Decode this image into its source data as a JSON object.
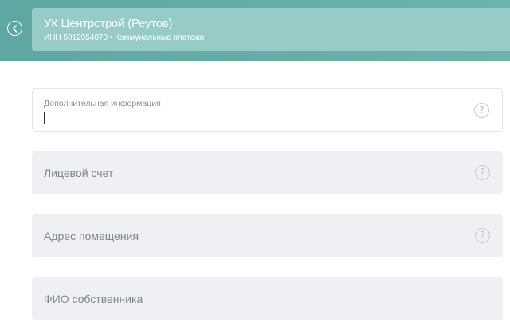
{
  "header": {
    "back_icon": "chevron-left-icon",
    "merchant": {
      "title": "УК Центрстрой (Реутов)",
      "subtitle": "ИНН 5012054070 • Коммунальные платежи"
    }
  },
  "form": {
    "fields": [
      {
        "label": "Дополнительная информация",
        "value": "",
        "state": "focused",
        "help_icon": "question-icon",
        "help_glyph": "?"
      },
      {
        "placeholder": "Лицевой счет",
        "state": "idle",
        "help_icon": "question-icon",
        "help_glyph": "?"
      },
      {
        "placeholder": "Адрес помещения",
        "state": "idle",
        "help_icon": "question-icon",
        "help_glyph": "?"
      },
      {
        "placeholder": "ФИО собственника",
        "state": "idle"
      }
    ]
  },
  "colors": {
    "header_band": "#5fa7a2",
    "merchant_card": "#97cbc7",
    "field_bg": "#eef0f4"
  }
}
